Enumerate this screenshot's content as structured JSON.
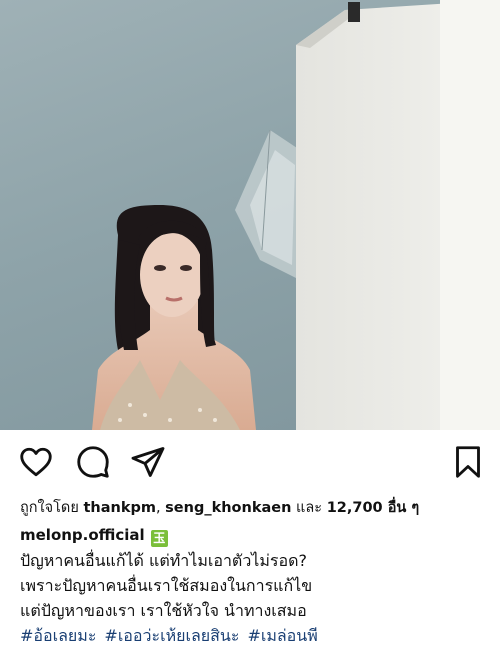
{
  "post": {
    "photo": {
      "subject": "woman-portrait",
      "background": "photo studio with umbrella light and white wall"
    },
    "actions": {
      "like_icon": "heart-outline-icon",
      "comment_icon": "comment-bubble-icon",
      "share_icon": "paper-plane-icon",
      "save_icon": "bookmark-outline-icon"
    },
    "likes": {
      "prefix": "ถูกใจโดย ",
      "user1": "thankpm",
      "separator": ", ",
      "user2": "seng_khonkaen",
      "middle": " และ ",
      "count": "12,700 อื่น ๆ"
    },
    "author": "melonp.official",
    "author_emoji": "玉",
    "caption": [
      "ปัญหาคนอื่นแก้ได้ แต่ทำไมเอาตัวไม่รอด?",
      "เพราะปัญหาคนอื่นเราใช้สมองในการแก้ไข",
      "แต่ปัญหาของเรา เราใช้หัวใจ นำทางเสมอ"
    ],
    "hashtags": [
      "#อ้อเลยมะ",
      "#เออว่ะเห้ยเลยสินะ",
      "#เมล่อนพี"
    ],
    "colors": {
      "hashtag": "#1a3f73",
      "text": "#111111"
    }
  }
}
